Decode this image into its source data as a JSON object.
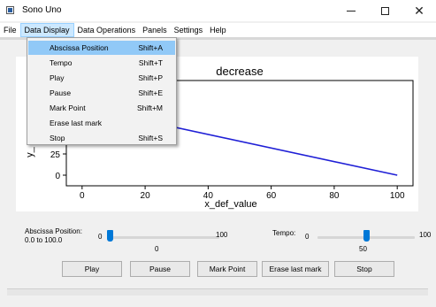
{
  "window": {
    "title": "Sono Uno",
    "controls": {
      "minimize": "–",
      "maximize": "☐",
      "close": "✕"
    }
  },
  "menubar": [
    {
      "label": "File"
    },
    {
      "label": "Data Display"
    },
    {
      "label": "Data Operations"
    },
    {
      "label": "Panels"
    },
    {
      "label": "Settings"
    },
    {
      "label": "Help"
    }
  ],
  "data_display_menu": [
    {
      "label": "Abscissa Position",
      "shortcut": "Shift+A"
    },
    {
      "label": "Tempo",
      "shortcut": "Shift+T"
    },
    {
      "label": "Play",
      "shortcut": "Shift+P"
    },
    {
      "label": "Pause",
      "shortcut": "Shift+E"
    },
    {
      "label": "Mark Point",
      "shortcut": "Shift+M"
    },
    {
      "label": "Erase last mark",
      "shortcut": ""
    },
    {
      "label": "Stop",
      "shortcut": "Shift+S"
    }
  ],
  "chart_data": {
    "type": "line",
    "title": "decrease",
    "xlabel": "x_def_value",
    "ylabel": "y_",
    "x_ticks": [
      "0",
      "20",
      "40",
      "60",
      "80",
      "100"
    ],
    "y_ticks": [
      "0",
      "25"
    ],
    "xlim": [
      -5,
      105
    ],
    "series": [
      {
        "x": [
          0,
          100
        ],
        "y": [
          80,
          0
        ],
        "color": "#1f1fd6"
      }
    ]
  },
  "controls": {
    "abscissa": {
      "label_line1": "Abscissa Position:",
      "label_line2": "0.0 to 100.0",
      "min": "0",
      "max": "100",
      "value": "0",
      "fraction": 0.0
    },
    "tempo": {
      "label": "Tempo:",
      "min": "0",
      "max": "100",
      "value": "50",
      "fraction": 0.5
    }
  },
  "buttons": {
    "play": "Play",
    "pause": "Pause",
    "mark_point": "Mark Point",
    "erase_last_mark": "Erase last mark",
    "stop": "Stop"
  }
}
